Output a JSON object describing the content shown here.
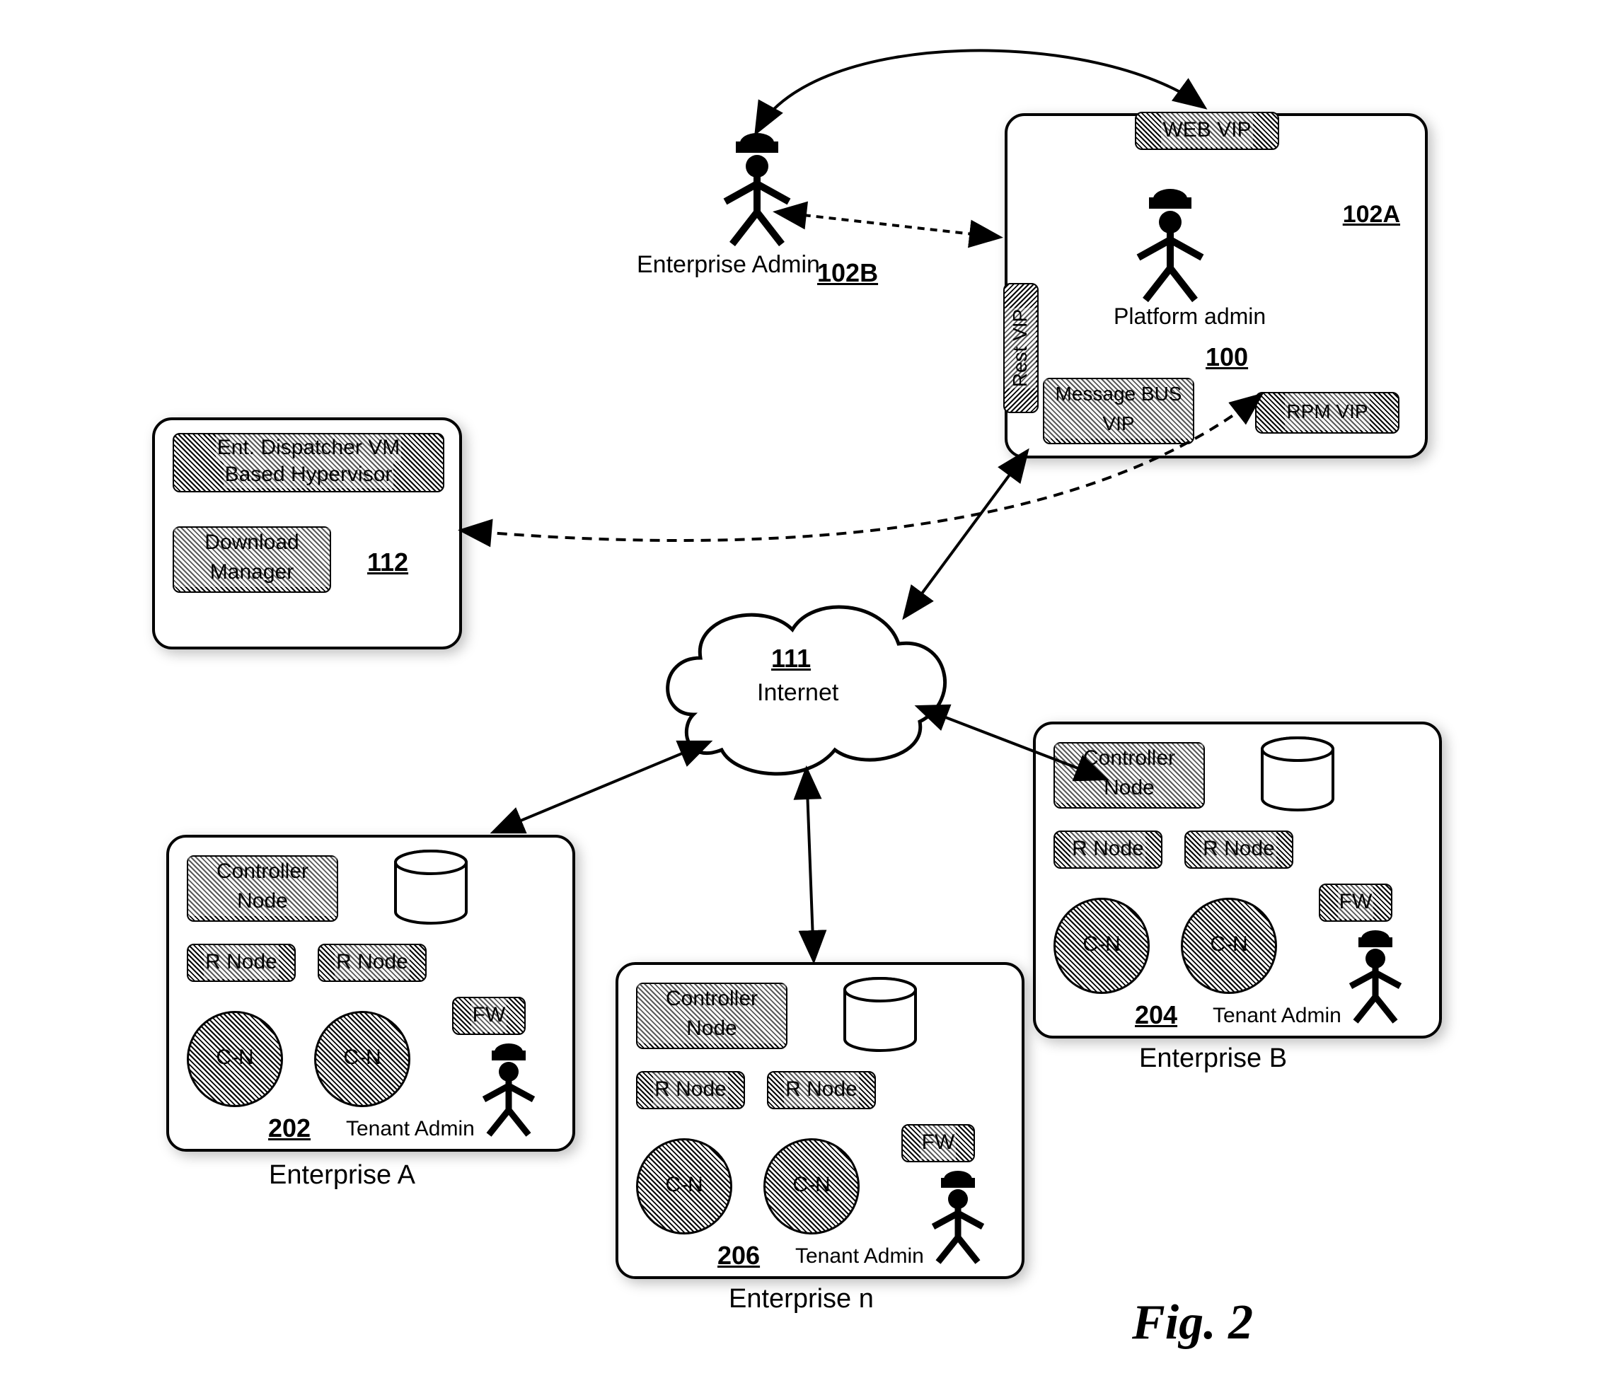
{
  "figure_caption": "Fig. 2",
  "dispatcher": {
    "ref": "112",
    "title1": "Ent. Dispatcher VM",
    "title2": "Based Hypervisor",
    "dl_mgr": "Download Manager"
  },
  "enterprise_admin": {
    "ref": "102B",
    "label": "Enterprise Admin"
  },
  "platform": {
    "ref": "102A",
    "internal_ref": "100",
    "label": "Platform admin",
    "rest_vip": "Rest VIP",
    "web_vip": "WEB VIP",
    "msg_bus_vip": "Message BUS VIP",
    "rpm_vip": "RPM VIP"
  },
  "internet": {
    "ref": "111",
    "label": "Internet"
  },
  "enterprise_a": {
    "ref": "202",
    "label": "Enterprise A",
    "admin": "Tenant Admin",
    "ctrl": "Controller Node",
    "rn1": "R Node",
    "rn2": "R Node",
    "cn1": "C-N",
    "cn2": "C-N",
    "fw": "FW"
  },
  "enterprise_b": {
    "ref": "204",
    "label": "Enterprise B",
    "admin": "Tenant Admin",
    "ctrl": "Controller Node",
    "rn1": "R Node",
    "rn2": "R Node",
    "cn1": "C-N",
    "cn2": "C-N",
    "fw": "FW"
  },
  "enterprise_n": {
    "ref": "206",
    "label": "Enterprise n",
    "admin": "Tenant Admin",
    "ctrl": "Controller Node",
    "rn1": "R Node",
    "rn2": "R Node",
    "cn1": "C-N",
    "cn2": "C-N",
    "fw": "FW"
  }
}
